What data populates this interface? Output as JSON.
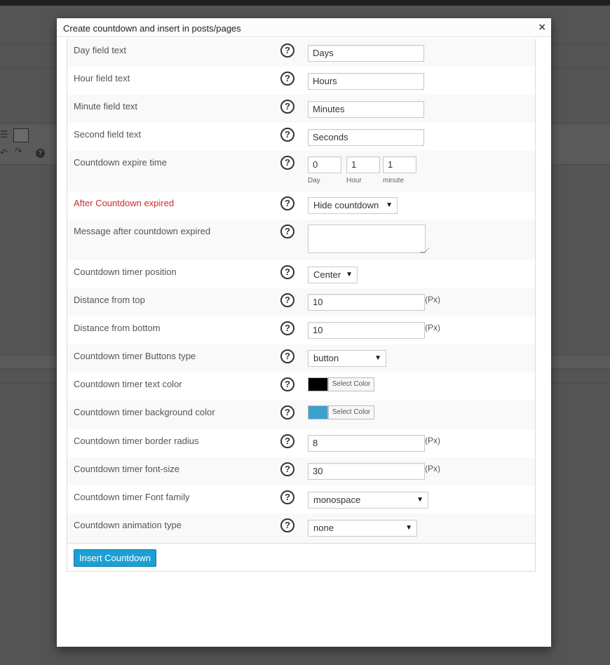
{
  "modal": {
    "title": "Create countdown and insert in posts/pages",
    "close_label": "×"
  },
  "help_glyph": "?",
  "fields": {
    "day": {
      "label": "Day field text",
      "value": "Days"
    },
    "hour": {
      "label": "Hour field text",
      "value": "Hours"
    },
    "minute": {
      "label": "Minute field text",
      "value": "Minutes"
    },
    "second": {
      "label": "Second field text",
      "value": "Seconds"
    },
    "expire": {
      "label": "Countdown expire time",
      "day_value": "0",
      "hour_value": "1",
      "minute_value": "1",
      "day_caption": "Day",
      "hour_caption": "Hour",
      "minute_caption": "minute"
    },
    "after_expired": {
      "label": "After Countdown expired",
      "value": "Hide countdown",
      "label_color": "#d02a2a"
    },
    "message": {
      "label": "Message after countdown expired",
      "value": ""
    },
    "position": {
      "label": "Countdown timer position",
      "value": "Center"
    },
    "distance_top": {
      "label": "Distance from top",
      "value": "10",
      "unit": "(Px)"
    },
    "distance_bottom": {
      "label": "Distance from bottom",
      "value": "10",
      "unit": "(Px)"
    },
    "buttons_type": {
      "label": "Countdown timer Buttons type",
      "value": "button"
    },
    "text_color": {
      "label": "Countdown timer text color",
      "color": "#000000",
      "button_label": "Select Color"
    },
    "bg_color": {
      "label": "Countdown timer background color",
      "color": "#3ba2cf",
      "button_label": "Select Color"
    },
    "border_radius": {
      "label": "Countdown timer border radius",
      "value": "8",
      "unit": "(Px)"
    },
    "font_size": {
      "label": "Countdown timer font-size",
      "value": "30",
      "unit": "(Px)"
    },
    "font_family": {
      "label": "Countdown timer Font family",
      "value": "monospace"
    },
    "animation": {
      "label": "Countdown animation type",
      "value": "none"
    }
  },
  "caret_glyph": "▼",
  "footer": {
    "insert_label": "Insert Countdown"
  },
  "colors": {
    "accent": "#1e9fd3",
    "warning_label": "#d02a2a"
  }
}
